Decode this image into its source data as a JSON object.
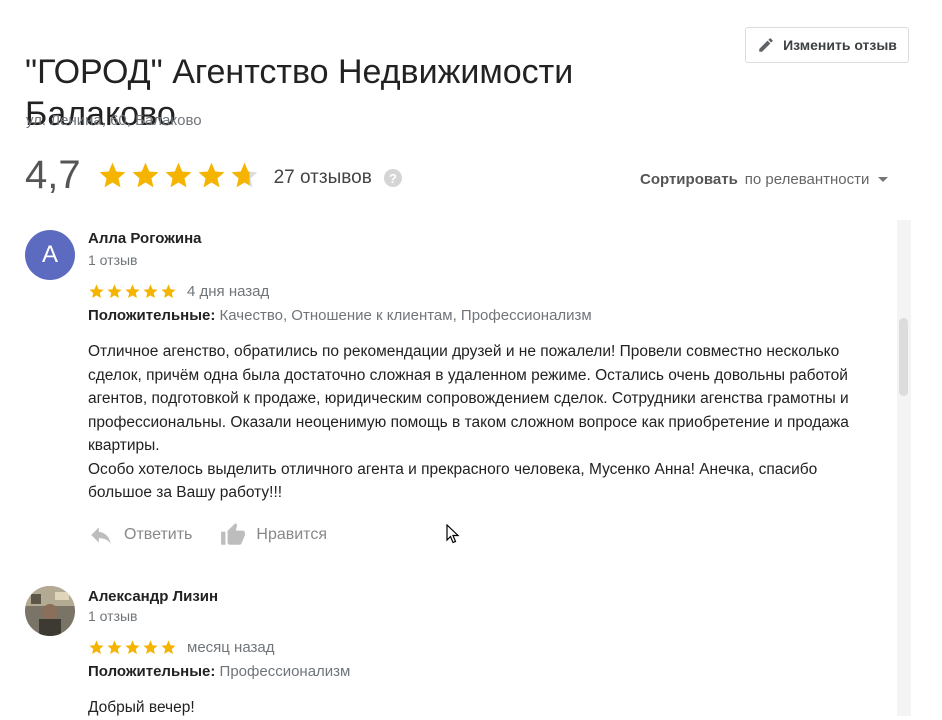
{
  "place": {
    "title": "\"ГОРОД\" Агентство Недвижимости Балаково",
    "address": "ул. Ленина, 60, Балаково"
  },
  "header": {
    "edit_review_label": "Изменить отзыв"
  },
  "summary": {
    "rating": "4,7",
    "rating_value": 4.7,
    "reviews_count": "27 отзывов"
  },
  "sort": {
    "label": "Сортировать",
    "value": "по релевантности"
  },
  "reviews": [
    {
      "avatar_letter": "А",
      "name": "Алла Рогожина",
      "review_count": "1 отзыв",
      "stars": 5,
      "date": "4 дня назад",
      "positives_label": "Положительные:",
      "positives": "Качество, Отношение к клиентам, Профессионализм",
      "text1": "Отличное агенство, обратились по рекомендации друзей и не пожалели! Провели совместно несколько сделок, причём одна была достаточно сложная в удаленном режиме. Остались очень довольны работой агентов, подготовкой к продаже, юридическим сопровождением сделок. Сотрудники агенства грамотны и профессиональны. Оказали неоценимую помощь в таком сложном вопросе как приобретение и продажа квартиры.",
      "text2": "Особо хотелось выделить отличного агента и прекрасного человека, Мусенко Анна! Анечка, спасибо большое за Вашу работу!!!",
      "reply_label": "Ответить",
      "like_label": "Нравится"
    },
    {
      "name": "Александр Лизин",
      "review_count": "1 отзыв",
      "stars": 5,
      "date": "месяц назад",
      "positives_label": "Положительные:",
      "positives": "Профессионализм",
      "text1": "Добрый вечер!"
    }
  ],
  "colors": {
    "star": "#f4b400",
    "avatar": "#5c6bc0"
  }
}
